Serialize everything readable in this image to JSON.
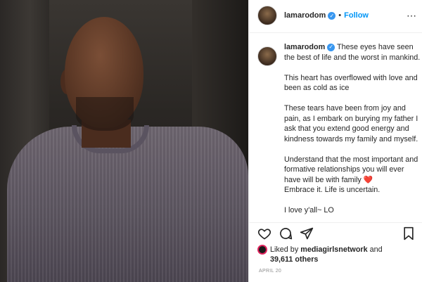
{
  "header": {
    "username": "lamarodom",
    "separator": "•",
    "follow_label": "Follow",
    "more_icon": "⋯"
  },
  "caption": {
    "username": "lamarodom",
    "paragraphs": [
      "These eyes have seen the best of life and the worst in mankind.",
      "This heart has overflowed with love and been as cold as ice",
      "These tears have been from joy and pain, as I embark on burying my father I ask that you extend good energy and kindness towards my family and myself.",
      "Understand that the most important and formative relationships you will ever have will be with family",
      "I love y'all~ LO"
    ],
    "p4_suffix": "Embrace it. Life is uncertain.",
    "heart": "❤️"
  },
  "likes": {
    "prefix": "Liked by",
    "by_user": "mediagirlsnetwork",
    "and": "and",
    "others": "39,611 others"
  },
  "date": "APRIL 20",
  "colors": {
    "link_blue": "#0095f6",
    "verified_blue": "#3897f0",
    "heart_red": "#e0245e",
    "text": "#262626",
    "muted": "#8e8e8e"
  }
}
